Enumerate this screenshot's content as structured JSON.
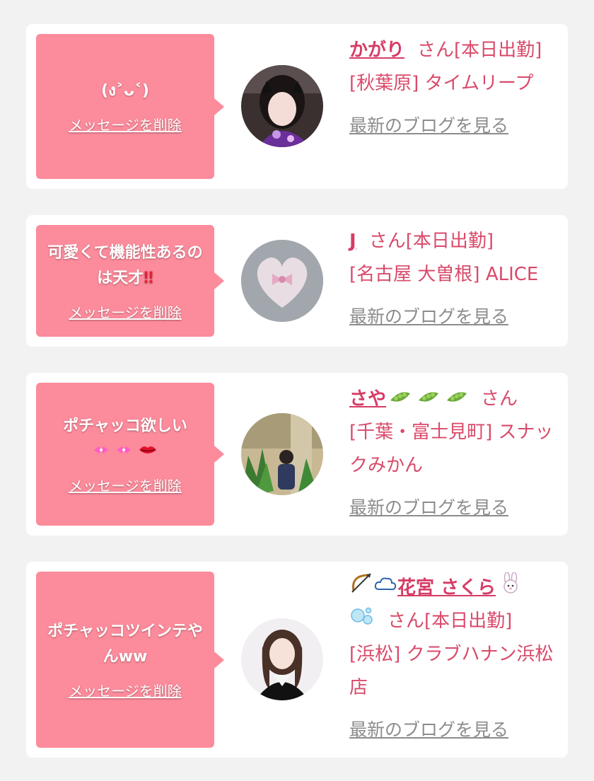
{
  "cards": [
    {
      "message": "(ง˃ᴗ˂)",
      "delete_label": "メッセージを削除",
      "name": "かがり",
      "san": "さん[本日出勤]",
      "shop": "[秋葉原] タイムリープ",
      "blog_label": "最新のブログを見る"
    },
    {
      "message": "可愛くて機能性あるのは天才",
      "message_suffix": "‼",
      "delete_label": "メッセージを削除",
      "name": "J",
      "san": "さん[本日出勤]",
      "shop": "[名古屋 大曽根] ALICE",
      "blog_label": "最新のブログを見る"
    },
    {
      "message": "ポチャッコ欲しい",
      "message_line2_icons": [
        "ribbon-sparkle-icon",
        "ribbon-sparkle-icon",
        "lips-icon"
      ],
      "delete_label": "メッセージを削除",
      "name": "さや",
      "name_icons": [
        "peapod-icon",
        "peapod-icon",
        "peapod-icon"
      ],
      "san": "さん",
      "shop": "[千葉・富士見町] スナックみかん",
      "blog_label": "最新のブログを見る"
    },
    {
      "message": "ポチャッコツインテやんww",
      "delete_label": "メッセージを削除",
      "name": "花宮 さくら",
      "name_prefix_icons": [
        "bow-and-arrow-icon",
        "cloud-icon"
      ],
      "name_suffix_icons": [
        "rabbit-face-icon",
        "bubbles-icon"
      ],
      "san": "さん[本日出勤]",
      "shop": "[浜松] クラブハナン浜松店",
      "blog_label": "最新のブログを見る"
    }
  ],
  "colors": {
    "background": "#f2f2f2",
    "card": "#ffffff",
    "bubble": "#fc8b9b",
    "name": "#d63c66",
    "shop": "#d94a6a",
    "blog_link": "#8c8c8c"
  }
}
